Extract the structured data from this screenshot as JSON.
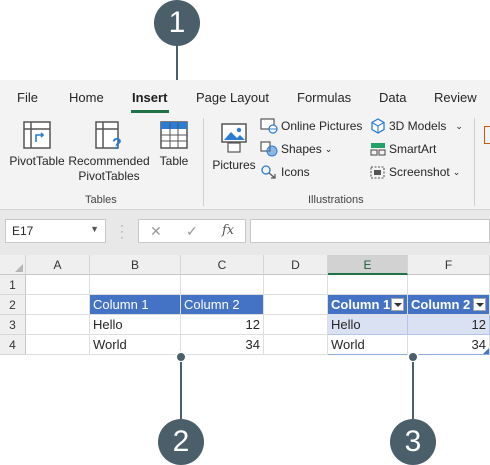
{
  "ribbon": {
    "tabs": [
      "File",
      "Home",
      "Insert",
      "Page Layout",
      "Formulas",
      "Data",
      "Review"
    ],
    "active_tab": "Insert",
    "tables_group": {
      "label": "Tables",
      "pivot_table": "PivotTable",
      "recommended_line1": "Recommended",
      "recommended_line2": "PivotTables",
      "table": "Table"
    },
    "illustrations_group": {
      "label": "Illustrations",
      "pictures": "Pictures",
      "online_pictures": "Online Pictures",
      "shapes": "Shapes",
      "icons": "Icons",
      "models_3d": "3D Models",
      "smartart": "SmartArt",
      "screenshot": "Screenshot"
    }
  },
  "formula_bar": {
    "name_box": "E17",
    "cancel_symbol": "✕",
    "enter_symbol": "✓",
    "fx_symbol": "fx",
    "formula": ""
  },
  "sheet": {
    "columns": [
      "A",
      "B",
      "C",
      "D",
      "E",
      "F"
    ],
    "rows": [
      "1",
      "2",
      "3",
      "4"
    ],
    "selected_column": "E",
    "range_table": {
      "headers": [
        "Column 1",
        "Column 2"
      ],
      "rows": [
        [
          "Hello",
          "12"
        ],
        [
          "World",
          "34"
        ]
      ]
    },
    "formatted_table": {
      "headers": [
        "Column 1",
        "Column 2"
      ],
      "rows": [
        [
          "Hello",
          "12"
        ],
        [
          "World",
          "34"
        ]
      ]
    }
  },
  "callouts": [
    "1",
    "2",
    "3"
  ],
  "colors": {
    "accent_green": "#217346",
    "table_header_blue": "#4472c4",
    "band_blue": "#d9e1f2",
    "callout": "#4a5f69"
  }
}
